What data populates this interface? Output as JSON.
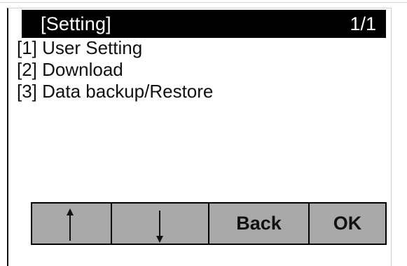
{
  "screen": {
    "title": "[Setting]",
    "page_indicator": "1/1"
  },
  "menu": {
    "items": [
      {
        "label": "[1] User Setting"
      },
      {
        "label": "[2] Download"
      },
      {
        "label": "[3] Data backup/Restore"
      }
    ]
  },
  "softkeys": {
    "up_icon": "arrow-up-icon",
    "down_icon": "arrow-down-icon",
    "back_label": "Back",
    "ok_label": "OK"
  },
  "colors": {
    "title_bar_bg": "#000000",
    "title_text": "#ffffff",
    "button_bg": "#a9a9a9",
    "border": "#000000"
  }
}
